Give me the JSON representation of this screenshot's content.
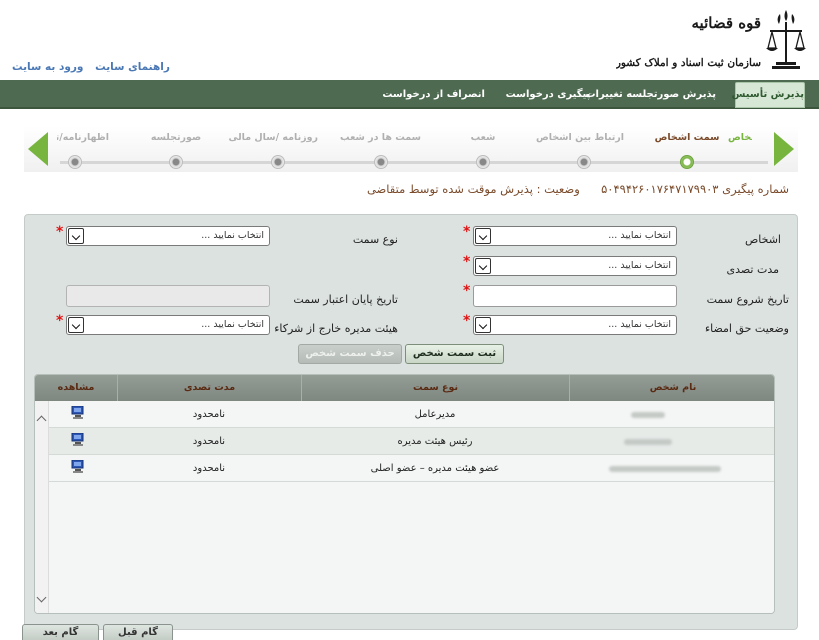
{
  "header": {
    "org_title": "قوه قضائیه",
    "org_subtitle": "سازمان ثبت اسناد و املاک کشور",
    "links": [
      "ورود به سایت",
      "راهنمای سایت"
    ]
  },
  "nav": {
    "items": [
      {
        "label": "پذیرش تأسیس",
        "active": true
      },
      {
        "label": "پذیرش صورتجلسه تغییرات",
        "active": false
      },
      {
        "label": "پیگیری درخواست",
        "active": false
      },
      {
        "label": "انصراف از درخواست",
        "active": false
      }
    ]
  },
  "wizard": {
    "steps": [
      {
        "label": "اشخاص",
        "state": "done"
      },
      {
        "label": "سمت اشخاص",
        "state": "current"
      },
      {
        "label": "ارتباط بین اشخاص",
        "state": "upcoming"
      },
      {
        "label": "شعب",
        "state": "upcoming"
      },
      {
        "label": "سمت ها در شعب",
        "state": "upcoming"
      },
      {
        "label": "روزنامه /سال مالی",
        "state": "upcoming"
      },
      {
        "label": "صورتجلسه",
        "state": "upcoming"
      },
      {
        "label": "اظهارنامه/تقاضا",
        "state": "upcoming"
      }
    ]
  },
  "status": {
    "tracking_label": "شماره پیگیری",
    "tracking_number": "۵۰۴۹۴۲۶۰۱۷۶۴۷۱۷۹۹۰۳",
    "state_label": "وضعیت :",
    "state_value": "پذیرش موقت شده توسط متقاضی"
  },
  "form": {
    "persons_label": "اشخاص",
    "persons_value": "انتخاب نمایید ...",
    "role_type_label": "نوع سمت",
    "role_type_value": "انتخاب نمایید ...",
    "tenure_label": "مدت تصدی",
    "tenure_value": "انتخاب نمایید ...",
    "start_date_label": "تاریخ شروع سمت",
    "end_date_label": "تاریخ پایان اعتبار سمت",
    "signature_label": "وضعیت حق امضاء",
    "signature_value": "انتخاب نمایید ...",
    "outside_board_label": "هیئت مدیره خارج از شرکاء",
    "outside_board_value": "انتخاب نمایید ...",
    "required_mark": "*",
    "submit_label": "ثبت سمت شخص",
    "delete_label": "حذف سمت شخص"
  },
  "grid": {
    "columns": [
      "نام شخص",
      "نوع سمت",
      "مدت تصدی",
      "مشاهده"
    ],
    "rows": [
      {
        "role": "مدیرعامل",
        "tenure": "نامحدود"
      },
      {
        "role": "رئیس هیئت مدیره",
        "tenure": "نامحدود"
      },
      {
        "role": "عضو هیئت مدیره – عضو اصلی",
        "tenure": "نامحدود"
      }
    ]
  },
  "bottom": {
    "next_label": "گام بعد",
    "prev_label": "گام قبل"
  },
  "colors": {
    "nav_bg": "#4e6a50",
    "accent_green": "#78b53f",
    "label_brown": "#7a4a2a",
    "required_red": "#e01414"
  }
}
